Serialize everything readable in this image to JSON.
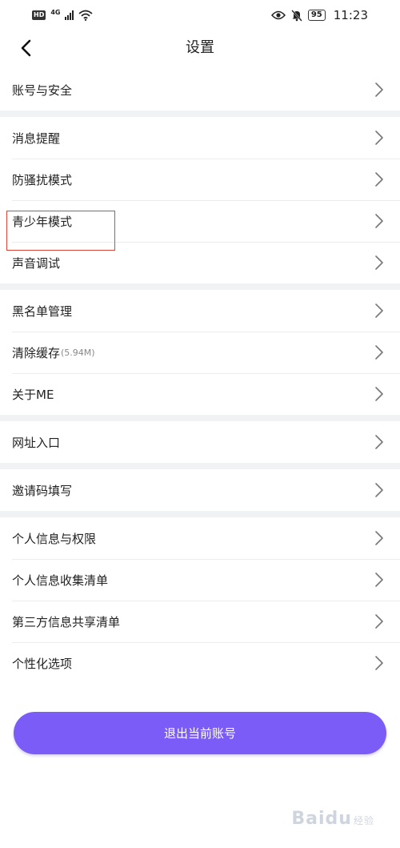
{
  "status_bar": {
    "hd": "HD",
    "network": "4G",
    "battery": "95",
    "time": "11:23",
    "icons": [
      "wifi-icon",
      "eye-icon",
      "bell-muted-icon"
    ]
  },
  "nav": {
    "title": "设置",
    "back_icon": "back-arrow-icon"
  },
  "groups": [
    [
      {
        "label": "账号与安全"
      }
    ],
    [
      {
        "label": "消息提醒"
      },
      {
        "label": "防骚扰模式"
      },
      {
        "label": "青少年模式"
      },
      {
        "label": "声音调试"
      }
    ],
    [
      {
        "label": "黑名单管理"
      },
      {
        "label": "清除缓存",
        "sub": "(5.94M)"
      },
      {
        "label": "关于ME"
      }
    ],
    [
      {
        "label": "网址入口"
      }
    ],
    [
      {
        "label": "邀请码填写"
      }
    ],
    [
      {
        "label": "个人信息与权限"
      },
      {
        "label": "个人信息收集清单"
      },
      {
        "label": "第三方信息共享清单"
      },
      {
        "label": "个性化选项"
      }
    ]
  ],
  "logout_label": "退出当前账号",
  "watermark": {
    "text": "Baidu",
    "sub": "经验"
  },
  "colors": {
    "accent": "#7b5cf7",
    "highlight_box": "#d9473b",
    "divider_gap": "#f1f2f4"
  }
}
